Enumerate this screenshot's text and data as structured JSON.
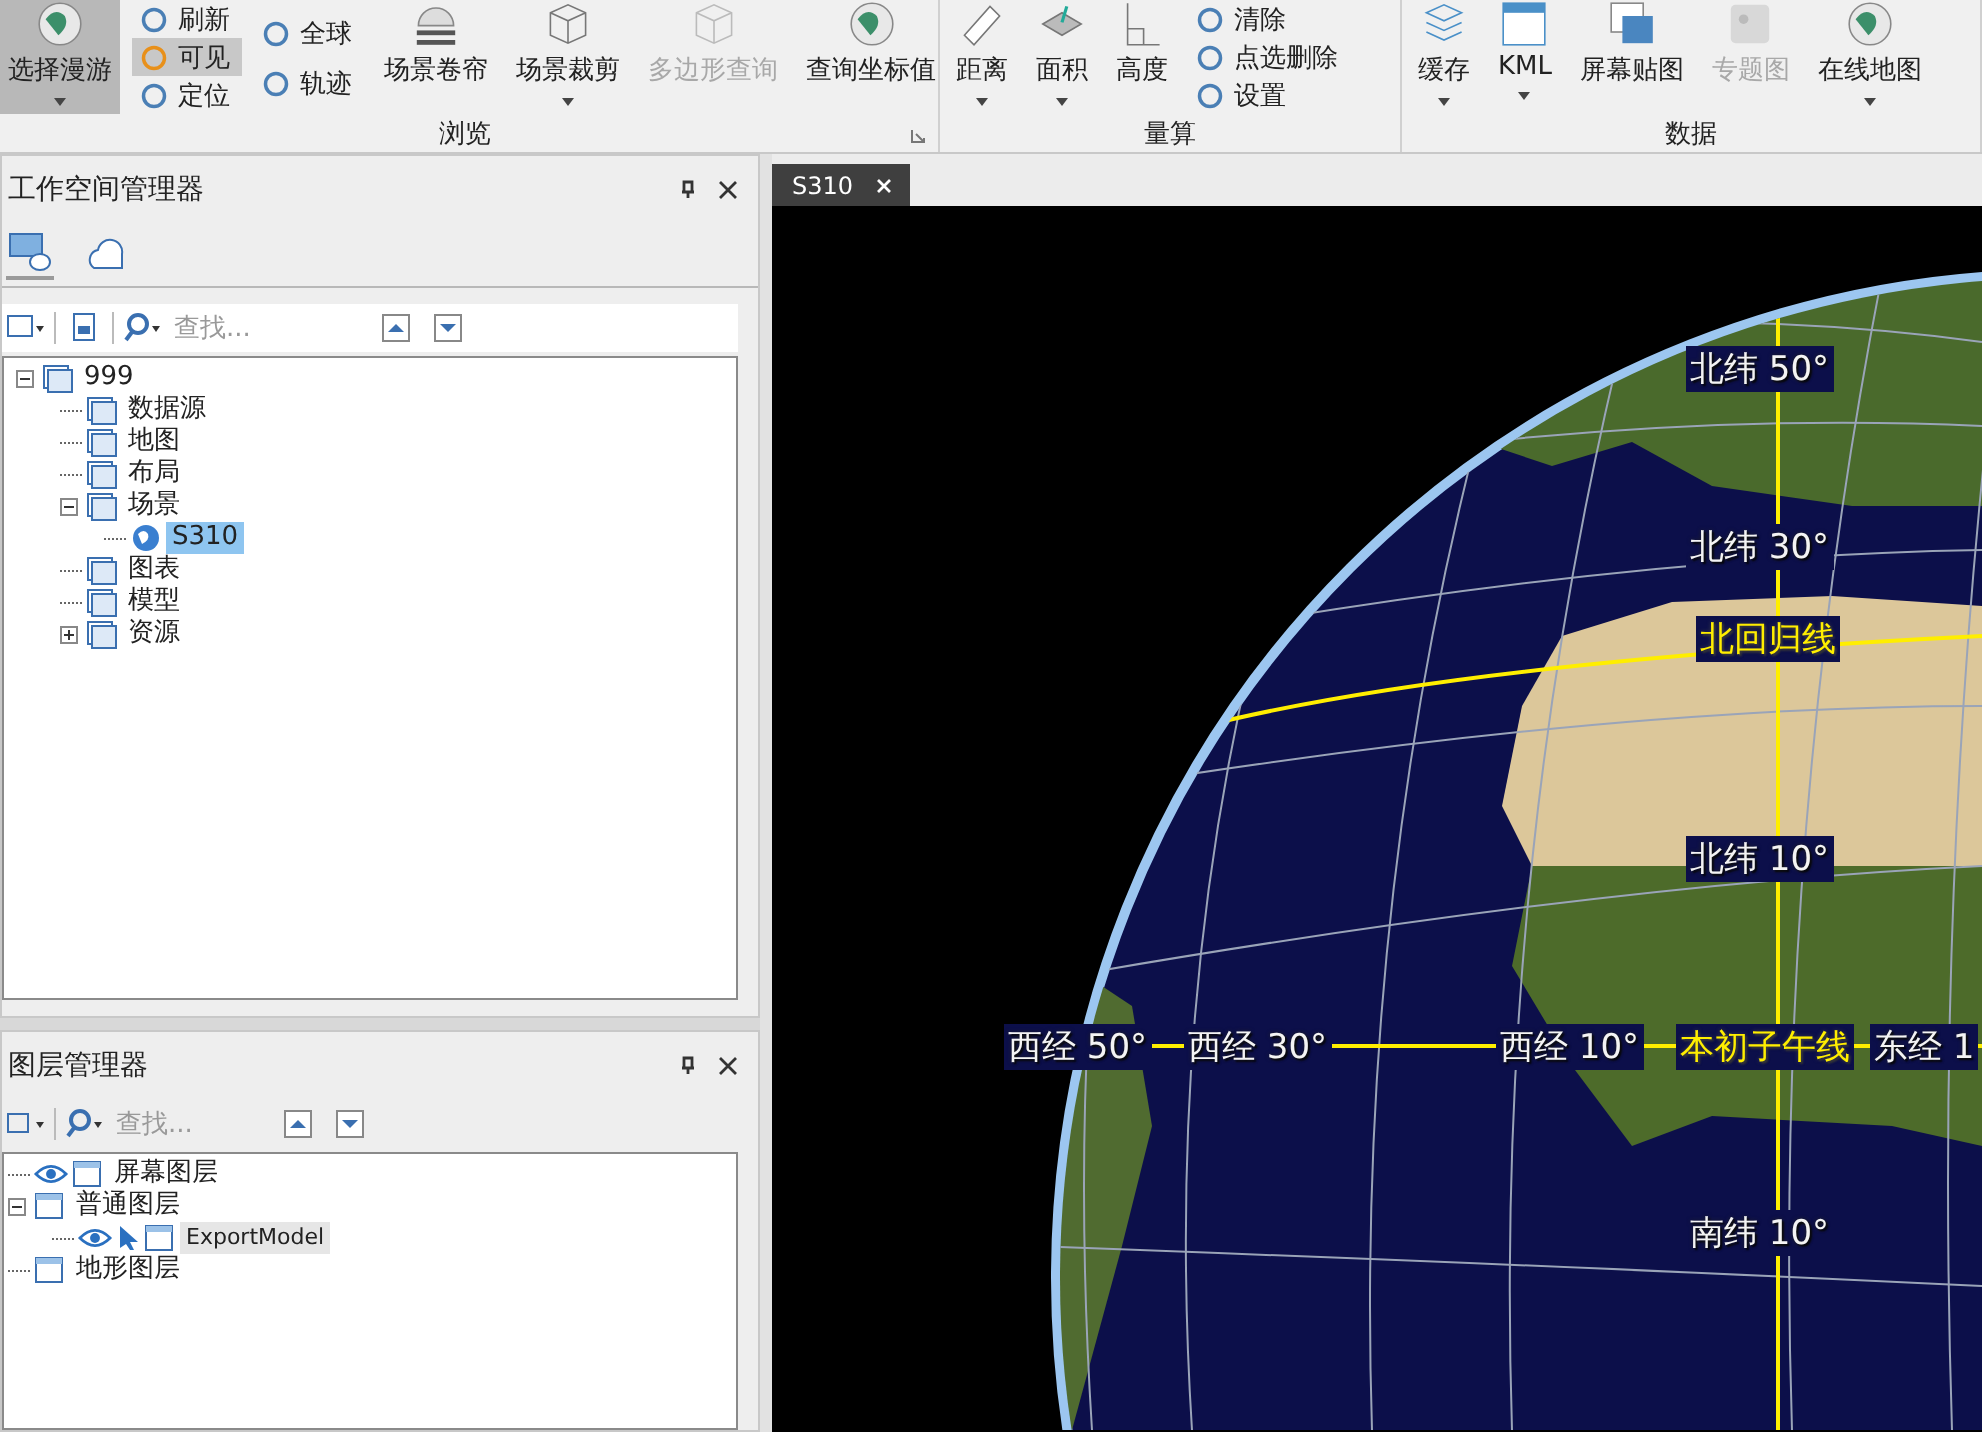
{
  "ribbon": {
    "groups": [
      {
        "label": "浏览",
        "launcher": true,
        "items": [
          {
            "kind": "large",
            "label": "选择漫游",
            "selected": true,
            "disabled": false,
            "dropdown": true
          },
          {
            "kind": "stack",
            "items": [
              {
                "label": "刷新",
                "selected": false
              },
              {
                "label": "可见",
                "selected": true
              },
              {
                "label": "定位",
                "selected": false
              }
            ]
          },
          {
            "kind": "stack",
            "items": [
              {
                "label": "全球",
                "selected": false
              },
              {
                "label": "轨迹",
                "selected": false
              }
            ]
          },
          {
            "kind": "large",
            "label": "场景卷帘",
            "selected": false,
            "disabled": false,
            "dropdown": false
          },
          {
            "kind": "large",
            "label": "场景裁剪",
            "selected": false,
            "disabled": false,
            "dropdown": true
          },
          {
            "kind": "large",
            "label": "多边形查询",
            "selected": false,
            "disabled": true,
            "dropdown": false
          },
          {
            "kind": "large",
            "label": "查询坐标值",
            "selected": false,
            "disabled": false,
            "dropdown": false
          }
        ]
      },
      {
        "label": "量算",
        "items": [
          {
            "kind": "large",
            "label": "距离",
            "selected": false,
            "disabled": false,
            "dropdown": true
          },
          {
            "kind": "large",
            "label": "面积",
            "selected": false,
            "disabled": false,
            "dropdown": true
          },
          {
            "kind": "large",
            "label": "高度",
            "selected": false,
            "disabled": false,
            "dropdown": false
          },
          {
            "kind": "stack",
            "items": [
              {
                "label": "清除",
                "selected": false
              },
              {
                "label": "点选删除",
                "selected": false
              },
              {
                "label": "设置",
                "selected": false
              }
            ]
          }
        ]
      },
      {
        "label": "数据",
        "items": [
          {
            "kind": "large",
            "label": "缓存",
            "selected": false,
            "disabled": false,
            "dropdown": true
          },
          {
            "kind": "large",
            "label": "KML",
            "selected": false,
            "disabled": false,
            "dropdown": true
          },
          {
            "kind": "large",
            "label": "屏幕贴图",
            "selected": false,
            "disabled": false,
            "dropdown": false
          },
          {
            "kind": "large",
            "label": "专题图",
            "selected": false,
            "disabled": true,
            "dropdown": false
          },
          {
            "kind": "large",
            "label": "在线地图",
            "selected": false,
            "disabled": false,
            "dropdown": true
          }
        ]
      }
    ]
  },
  "workspace": {
    "title": "工作空间管理器",
    "tabs": [
      {
        "selected": true
      },
      {
        "selected": false
      }
    ],
    "search": {
      "placeholder": "查找..."
    },
    "tree": [
      {
        "label": "999",
        "expanded": true,
        "selected": false,
        "children": [
          {
            "label": "数据源",
            "selected": false
          },
          {
            "label": "地图",
            "selected": false
          },
          {
            "label": "布局",
            "selected": false
          },
          {
            "label": "场景",
            "expanded": true,
            "selected": false,
            "children": [
              {
                "label": "S310",
                "selected": true
              }
            ]
          },
          {
            "label": "图表",
            "selected": false
          },
          {
            "label": "模型",
            "selected": false
          },
          {
            "label": "资源",
            "expanded": false,
            "selected": false
          }
        ]
      }
    ]
  },
  "layers": {
    "title": "图层管理器",
    "search": {
      "placeholder": "查找..."
    },
    "tree": [
      {
        "label": "屏幕图层",
        "visible": true,
        "selected": false
      },
      {
        "label": "普通图层",
        "expanded": true,
        "selected": false,
        "children": [
          {
            "label": "ExportModel",
            "visible": true,
            "selectable": true,
            "selected": true
          }
        ]
      },
      {
        "label": "地形图层",
        "selected": false
      }
    ]
  },
  "scene": {
    "tabs": [
      {
        "label": "S310",
        "selected": true
      }
    ],
    "labels": [
      {
        "kind": "grid",
        "text": "北纬 50°"
      },
      {
        "kind": "grid",
        "text": "北纬 30°"
      },
      {
        "kind": "line",
        "text": "北回归线"
      },
      {
        "kind": "grid",
        "text": "北纬 10°"
      },
      {
        "kind": "grid",
        "text": "西经 50°"
      },
      {
        "kind": "grid",
        "text": "西经 30°"
      },
      {
        "kind": "grid",
        "text": "西经 10°"
      },
      {
        "kind": "line",
        "text": "本初子午线"
      },
      {
        "kind": "grid",
        "text": "东经 1"
      },
      {
        "kind": "grid",
        "text": "南纬 10°"
      }
    ]
  }
}
